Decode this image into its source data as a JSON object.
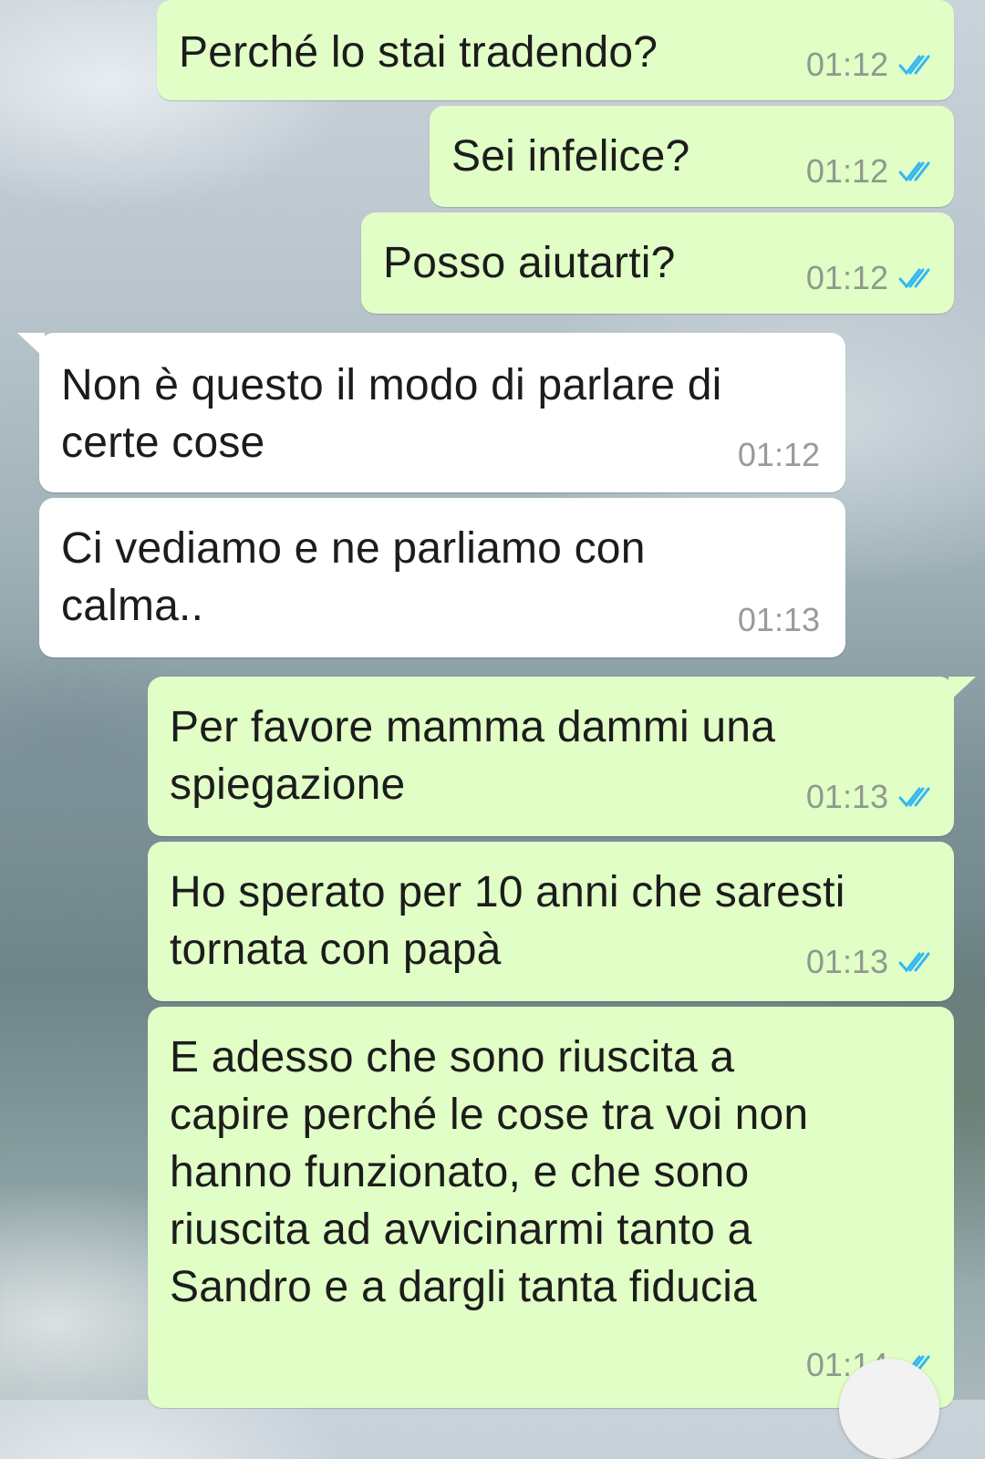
{
  "messages": [
    {
      "direction": "outgoing",
      "text": "Perché lo stai tradendo?",
      "time": "01:12",
      "status": "read"
    },
    {
      "direction": "outgoing",
      "text": "Sei infelice?",
      "time": "01:12",
      "status": "read"
    },
    {
      "direction": "outgoing",
      "text": "Posso aiutarti?",
      "time": "01:12",
      "status": "read"
    },
    {
      "direction": "incoming",
      "text": "Non è questo il modo di parlare di\ncerte cose",
      "time": "01:12"
    },
    {
      "direction": "incoming",
      "text": "Ci vediamo e ne parliamo con\ncalma..",
      "time": "01:13"
    },
    {
      "direction": "outgoing",
      "text": "Per favore mamma dammi una\nspiegazione",
      "time": "01:13",
      "status": "read"
    },
    {
      "direction": "outgoing",
      "text": "Ho sperato per 10 anni che saresti\ntornata con papà",
      "time": "01:13",
      "status": "read"
    },
    {
      "direction": "outgoing",
      "text": "E adesso che sono riuscita a\ncapire perché le cose tra voi non\nhanno funzionato, e che sono\nriuscita ad avvicinarmi tanto a\nSandro e a dargli tanta fiducia",
      "time": "01:14",
      "status": "read"
    }
  ],
  "colors": {
    "outgoing_bubble": "#e1fec6",
    "incoming_bubble": "#ffffff",
    "read_ticks": "#34b7f1",
    "timestamp": "#8e9a8e"
  },
  "icons": {
    "read_receipt": "double-check-icon"
  }
}
